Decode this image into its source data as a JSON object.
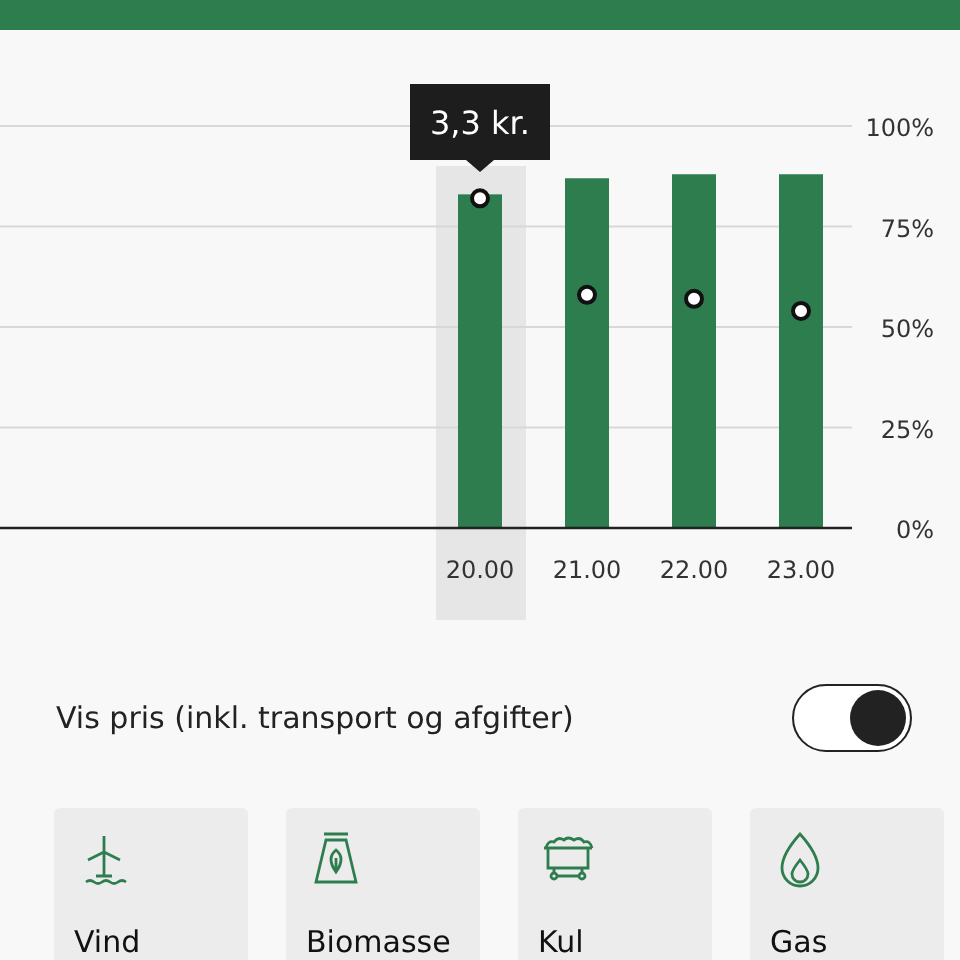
{
  "chart": {
    "tooltip": "3,3 kr.",
    "columns": [
      {
        "selected": true
      },
      {
        "selected": false
      },
      {
        "selected": false
      },
      {
        "selected": false
      }
    ],
    "chart_data": {
      "type": "bar",
      "grid": true,
      "categories": [
        "20.00",
        "21.00",
        "22.00",
        "23.00"
      ],
      "ylim": [
        0,
        100
      ],
      "yticks": [
        {
          "value": 0,
          "label": "0%"
        },
        {
          "value": 25,
          "label": "25%"
        },
        {
          "value": 50,
          "label": "50%"
        },
        {
          "value": 75,
          "label": "75%"
        },
        {
          "value": 100,
          "label": "100%"
        }
      ],
      "series": [
        {
          "color": "#2e7d4f",
          "values": [
            83,
            87,
            88,
            88
          ]
        },
        {
          "type": "scatter",
          "color": "#111111",
          "values": [
            82,
            58,
            57,
            54
          ]
        }
      ]
    }
  },
  "price_toggle": {
    "label": "Vis pris (inkl. transport og afgifter)",
    "on": true
  },
  "sources": [
    {
      "kind": "wind",
      "label": "Vind"
    },
    {
      "kind": "biomass",
      "label": "Biomasse"
    },
    {
      "kind": "coal",
      "label": "Kul"
    },
    {
      "kind": "gas",
      "label": "Gas"
    }
  ]
}
